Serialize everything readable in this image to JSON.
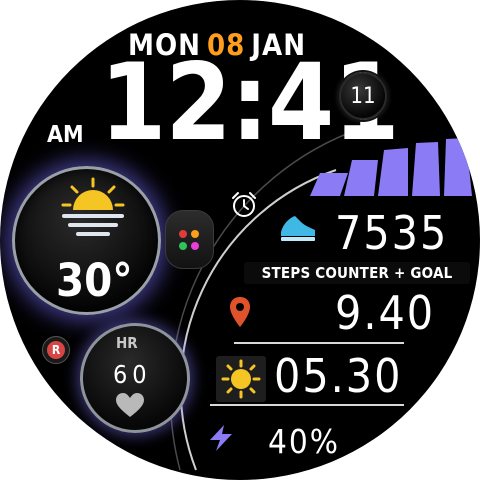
{
  "date": {
    "weekday": "MON",
    "day": "08",
    "month": "JAN"
  },
  "time": {
    "hours_minutes": "12:41",
    "seconds": "11",
    "ampm": "AM"
  },
  "weather": {
    "icon": "sun-over-horizon-icon",
    "temperature": "30°"
  },
  "alarm": {
    "icon": "alarm-clock-icon"
  },
  "dots_widget": {
    "colors": [
      "#e23b3b",
      "#ff9d1c",
      "#2ec45a",
      "#e83fd8"
    ]
  },
  "steps": {
    "icon": "sneaker-icon",
    "value": "7535",
    "label": "STEPS COUNTER + GOAL",
    "goal_bars_filled": 5,
    "goal_bars_total": 5
  },
  "distance": {
    "icon": "location-pin-icon",
    "value": "9.40"
  },
  "sunrise": {
    "icon": "sun-icon",
    "value": "05.30"
  },
  "heart_rate": {
    "label": "HR",
    "value": "60",
    "icon": "heart-icon"
  },
  "battery": {
    "icon": "lightning-bolt-icon",
    "value": "40%"
  },
  "reminder": {
    "letter": "R"
  },
  "colors": {
    "accent_purple": "#8b7cf6",
    "accent_orange": "#ff9d1c",
    "pin_red": "#e0522c",
    "steps_cyan": "#3fb8e6",
    "sun_yellow": "#f5c623"
  }
}
